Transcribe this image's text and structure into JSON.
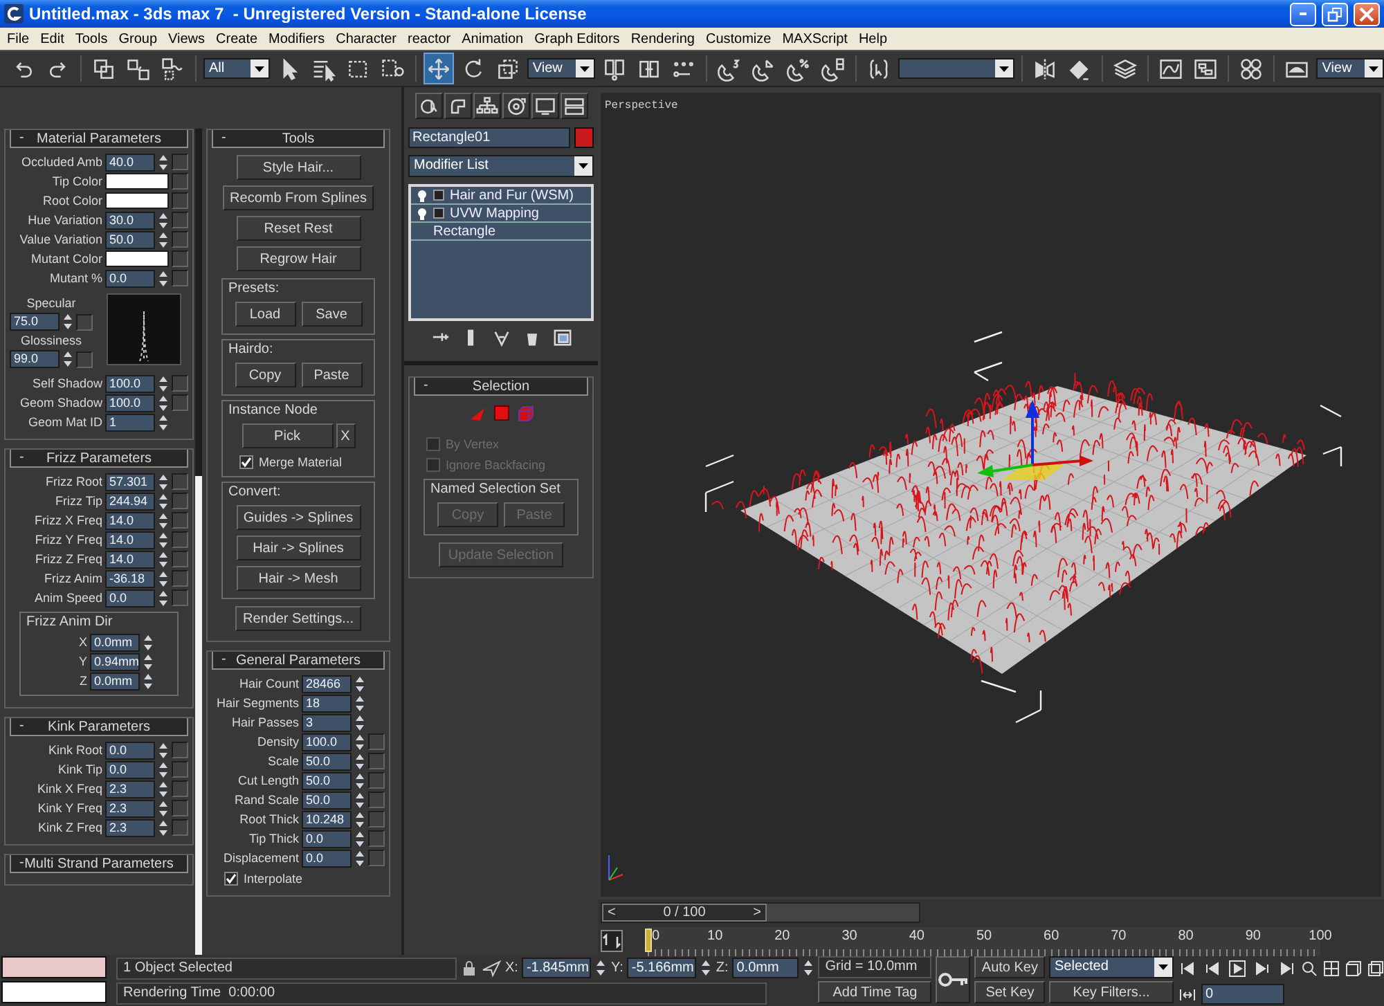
{
  "window": {
    "title": "Untitled.max - 3ds max 7  - Unregistered Version - Stand-alone License"
  },
  "menu": [
    "File",
    "Edit",
    "Tools",
    "Group",
    "Views",
    "Create",
    "Modifiers",
    "Character",
    "reactor",
    "Animation",
    "Graph Editors",
    "Rendering",
    "Customize",
    "MAXScript",
    "Help"
  ],
  "toolbar": [
    {
      "kind": "undo",
      "selected": false
    },
    {
      "kind": "redo",
      "selected": false
    },
    {
      "kind": "separator"
    },
    {
      "kind": "link",
      "selected": false
    },
    {
      "kind": "unlink",
      "selected": false
    },
    {
      "kind": "bind",
      "selected": false
    },
    {
      "kind": "separator"
    },
    {
      "kind": "dropdown",
      "value": "All"
    },
    {
      "kind": "select",
      "selected": false
    },
    {
      "kind": "select_by_name",
      "selected": false
    },
    {
      "kind": "region",
      "selected": false
    },
    {
      "kind": "window_crossing",
      "selected": false
    },
    {
      "kind": "separator"
    },
    {
      "kind": "move",
      "selected": true
    },
    {
      "kind": "rotate",
      "selected": false
    },
    {
      "kind": "scale",
      "selected": false
    },
    {
      "kind": "dropdown",
      "value": "View"
    },
    {
      "kind": "pivot",
      "selected": false
    },
    {
      "kind": "manipulate",
      "selected": false
    },
    {
      "kind": "shortcut_override",
      "selected": false
    },
    {
      "kind": "separator"
    },
    {
      "kind": "snap_3d",
      "selected": false
    },
    {
      "kind": "angle_snap",
      "selected": false
    },
    {
      "kind": "percent_snap",
      "selected": false
    },
    {
      "kind": "spinner_snap",
      "selected": false
    },
    {
      "kind": "separator"
    },
    {
      "kind": "named_selection_edit",
      "selected": false
    },
    {
      "kind": "dropdown"
    },
    {
      "kind": "separator"
    },
    {
      "kind": "mirror",
      "selected": false
    },
    {
      "kind": "align",
      "selected": false
    },
    {
      "kind": "separator"
    },
    {
      "kind": "layers",
      "selected": false
    },
    {
      "kind": "separator"
    },
    {
      "kind": "curve_editor",
      "selected": false
    },
    {
      "kind": "schematic",
      "selected": false
    },
    {
      "kind": "separator"
    },
    {
      "kind": "material_editor",
      "selected": false
    },
    {
      "kind": "separator"
    },
    {
      "kind": "render",
      "selected": false
    },
    {
      "kind": "dropdown",
      "value": "View"
    }
  ],
  "panels": {
    "columns": [
      [
        {
          "sign": "-",
          "title": "Material Parameters",
          "rows": [
            {
              "kind": "map_spinner",
              "label": "Occluded Amb",
              "value": "40.0"
            },
            {
              "kind": "color",
              "label": "Tip Color",
              "color": "#ffffff"
            },
            {
              "kind": "color",
              "label": "Root Color",
              "color": "#ffffff"
            },
            {
              "kind": "map_spinner",
              "label": "Hue Variation",
              "value": "30.0"
            },
            {
              "kind": "map_spinner",
              "label": "Value Variation",
              "value": "50.0"
            },
            {
              "kind": "color",
              "label": "Mutant Color",
              "color": "#ffffff"
            },
            {
              "kind": "map_spinner",
              "label": "Mutant %",
              "value": "0.0"
            },
            {
              "kind": "highlight",
              "specular_label": "Specular",
              "specular": "75.0",
              "glossiness_label": "Glossiness",
              "glossiness": "99.0"
            },
            {
              "kind": "map_spinner",
              "label": "Self Shadow",
              "value": "100.0"
            },
            {
              "kind": "map_spinner",
              "label": "Geom Shadow",
              "value": "100.0"
            },
            {
              "kind": "spinner",
              "label": "Geom Mat ID",
              "value": "1"
            }
          ]
        },
        {
          "sign": "-",
          "title": "Frizz Parameters",
          "rows": [
            {
              "kind": "map_spinner",
              "label": "Frizz Root",
              "value": "57.301"
            },
            {
              "kind": "map_spinner",
              "label": "Frizz Tip",
              "value": "244.94"
            },
            {
              "kind": "map_spinner",
              "label": "Frizz X Freq",
              "value": "14.0"
            },
            {
              "kind": "map_spinner",
              "label": "Frizz Y Freq",
              "value": "14.0"
            },
            {
              "kind": "map_spinner",
              "label": "Frizz Z Freq",
              "value": "14.0"
            },
            {
              "kind": "map_spinner",
              "label": "Frizz Anim",
              "value": "-36.18"
            },
            {
              "kind": "map_spinner",
              "label": "Anim Speed",
              "value": "0.0"
            },
            {
              "kind": "group",
              "title": "Frizz Anim Dir",
              "rows": [
                {
                  "kind": "spinner",
                  "label": "X",
                  "value": "0.0mm"
                },
                {
                  "kind": "spinner",
                  "label": "Y",
                  "value": "0.94mm"
                },
                {
                  "kind": "spinner",
                  "label": "Z",
                  "value": "0.0mm"
                }
              ]
            }
          ]
        },
        {
          "sign": "-",
          "title": "Kink Parameters",
          "rows": [
            {
              "kind": "map_spinner",
              "label": "Kink Root",
              "value": "0.0"
            },
            {
              "kind": "map_spinner",
              "label": "Kink Tip",
              "value": "0.0"
            },
            {
              "kind": "map_spinner",
              "label": "Kink X Freq",
              "value": "2.3"
            },
            {
              "kind": "map_spinner",
              "label": "Kink Y Freq",
              "value": "2.3"
            },
            {
              "kind": "map_spinner",
              "label": "Kink Z Freq",
              "value": "2.3"
            }
          ]
        },
        {
          "sign": "-",
          "title": "Multi Strand Parameters"
        }
      ],
      [
        {
          "sign": "-",
          "title": "Tools",
          "rows": [
            {
              "kind": "button",
              "label": "Style Hair...",
              "disabled": false
            },
            {
              "kind": "button",
              "label": "Recomb From Splines",
              "disabled": false
            },
            {
              "kind": "button",
              "label": "Reset Rest",
              "disabled": false
            },
            {
              "kind": "button",
              "label": "Regrow Hair",
              "disabled": false
            },
            {
              "kind": "group",
              "title": "Presets:",
              "rows": [
                {
                  "kind": "button_pair",
                  "buttons": [
                    {
                      "label": "Load",
                      "disabled": false
                    },
                    {
                      "label": "Save",
                      "disabled": false
                    }
                  ]
                }
              ]
            },
            {
              "kind": "group",
              "title": "Hairdo:",
              "rows": [
                {
                  "kind": "button_pair",
                  "buttons": [
                    {
                      "label": "Copy",
                      "disabled": false
                    },
                    {
                      "label": "Paste",
                      "disabled": false
                    }
                  ]
                }
              ]
            },
            {
              "kind": "group",
              "title": "Instance Node",
              "rows": [
                {
                  "kind": "pick",
                  "button": "Pick",
                  "clear": "X"
                },
                {
                  "kind": "checkbox",
                  "label": "Merge Material",
                  "checked": true,
                  "disabled": false
                }
              ]
            },
            {
              "kind": "group",
              "title": "Convert:",
              "rows": [
                {
                  "kind": "button",
                  "label": "Guides -> Splines",
                  "disabled": false
                },
                {
                  "kind": "button",
                  "label": "Hair -> Splines",
                  "disabled": false
                },
                {
                  "kind": "button",
                  "label": "Hair -> Mesh",
                  "disabled": false
                }
              ]
            },
            {
              "kind": "button",
              "label": "Render Settings...",
              "disabled": false
            }
          ]
        },
        {
          "sign": "-",
          "title": "General Parameters",
          "rows": [
            {
              "kind": "spinner",
              "label": "Hair Count",
              "value": "28466"
            },
            {
              "kind": "spinner",
              "label": "Hair Segments",
              "value": "18"
            },
            {
              "kind": "spinner",
              "label": "Hair Passes",
              "value": "3"
            },
            {
              "kind": "map_spinner",
              "label": "Density",
              "value": "100.0"
            },
            {
              "kind": "map_spinner",
              "label": "Scale",
              "value": "50.0"
            },
            {
              "kind": "map_spinner",
              "label": "Cut Length",
              "value": "50.0"
            },
            {
              "kind": "map_spinner",
              "label": "Rand Scale",
              "value": "50.0"
            },
            {
              "kind": "map_spinner",
              "label": "Root Thick",
              "value": "10.248"
            },
            {
              "kind": "map_spinner",
              "label": "Tip Thick",
              "value": "0.0"
            },
            {
              "kind": "map_spinner",
              "label": "Displacement",
              "value": "0.0"
            },
            {
              "kind": "checkbox",
              "label": "Interpolate",
              "checked": true,
              "disabled": false
            }
          ]
        }
      ]
    ]
  },
  "command_panel": {
    "object": {
      "name": "Rectangle01",
      "color": "#c81a1a"
    },
    "modifier_list": "Modifier List",
    "stack": [
      {
        "kind": "modifier",
        "label": "Hair and Fur (WSM)"
      },
      {
        "kind": "modifier",
        "label": "UVW Mapping"
      },
      {
        "kind": "base",
        "label": "Rectangle"
      }
    ],
    "rollouts": [
      {
        "sign": "-",
        "title": "Selection",
        "rows": [
          {
            "kind": "subobject_icons"
          },
          {
            "kind": "checkbox",
            "label": "By Vertex",
            "checked": false,
            "disabled": true
          },
          {
            "kind": "checkbox",
            "label": "Ignore Backfacing",
            "checked": false,
            "disabled": true
          },
          {
            "kind": "group",
            "title": "Named Selection Set",
            "rows": [
              {
                "kind": "button_pair",
                "buttons": [
                  {
                    "label": "Copy",
                    "disabled": true
                  },
                  {
                    "label": "Paste",
                    "disabled": true
                  }
                ]
              }
            ]
          },
          {
            "kind": "button",
            "label": "Update Selection",
            "disabled": true
          }
        ]
      }
    ]
  },
  "viewport": {
    "label": "Perspective"
  },
  "timeline": {
    "prev": "<",
    "next": ">",
    "frame_readout": "0 / 100",
    "level": 0,
    "ticks": [
      "0",
      "10",
      "20",
      "30",
      "40",
      "50",
      "60",
      "70",
      "80",
      "90",
      "100"
    ]
  },
  "status_bar": {
    "prompt": "1 Object Selected",
    "rendering_time": "Rendering Time  0:00:00",
    "x_label": "X:",
    "x": "-1.845mm",
    "y_label": "Y:",
    "y": "-5.166mm",
    "z_label": "Z:",
    "z": "0.0mm",
    "grid": "Grid = 10.0mm",
    "add_time_tag": "Add Time Tag",
    "auto_key": "Auto Key",
    "set_key": "Set Key",
    "key_set": "Selected",
    "key_filters": "Key Filters...",
    "current_frame": "0"
  }
}
